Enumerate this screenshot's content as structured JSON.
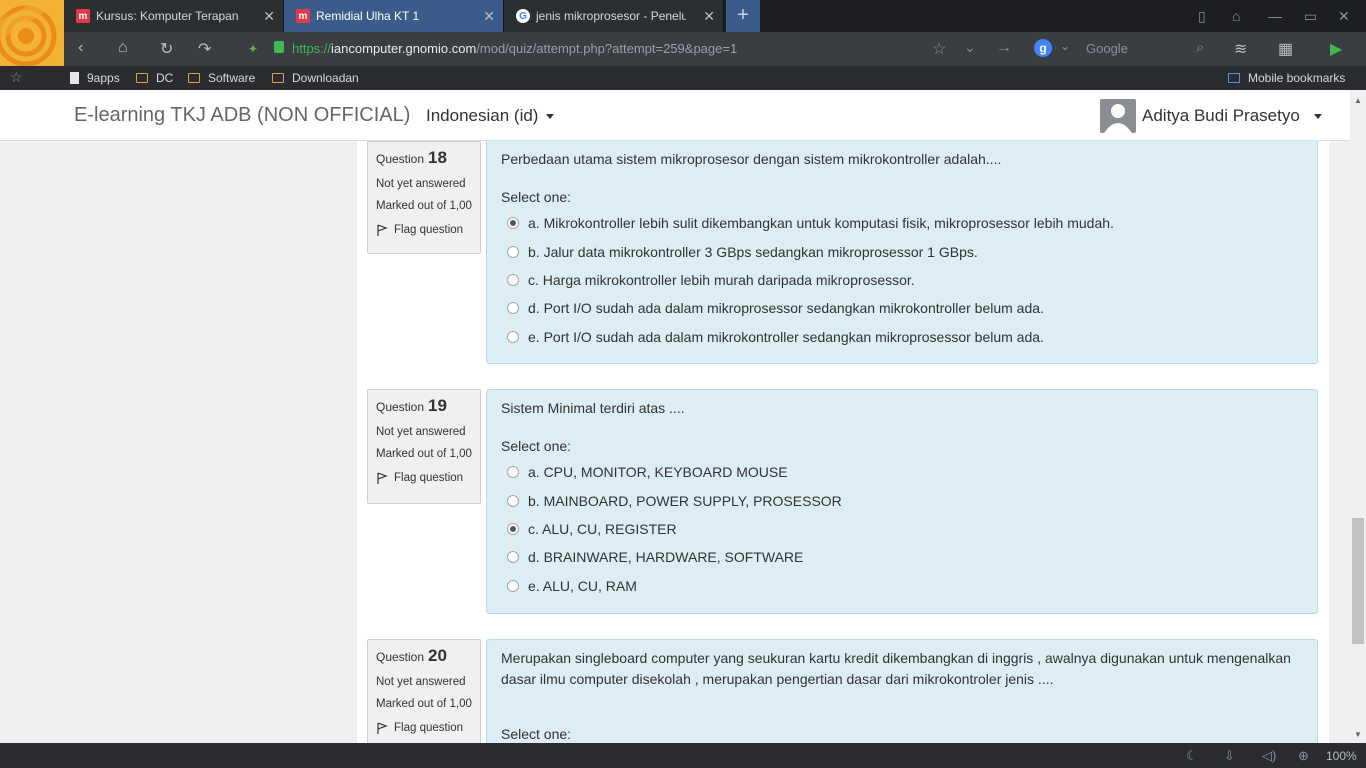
{
  "browser": {
    "tabs": [
      {
        "title": "Kursus: Komputer Terapan",
        "favicon": "moodle-icon",
        "active": false
      },
      {
        "title": "Remidial Ulha KT 1",
        "favicon": "moodle-icon",
        "active": true
      },
      {
        "title": "jenis mikroprosesor - Penelu",
        "favicon": "google-icon",
        "active": false
      }
    ],
    "url": {
      "scheme": "https://",
      "host": "iancomputer.gnomio.com",
      "path": "/mod/quiz/attempt.php?attempt=259&page=1"
    },
    "search_placeholder": "Google",
    "search_engine_icon": "g",
    "bookmarks": [
      "9apps",
      "DC",
      "Software",
      "Downloadan"
    ],
    "mobile_bookmarks": "Mobile bookmarks",
    "zoom": "100%"
  },
  "navbar": {
    "brand": "E-learning TKJ ADB (NON OFFICIAL)",
    "language": "Indonesian (id)",
    "user": "Aditya Budi Prasetyo"
  },
  "questions": [
    {
      "label": "Question",
      "number": "18",
      "state": "Not yet answered",
      "mark": "Marked out of 1,00",
      "flag": "Flag question",
      "text": "Perbedaan utama sistem mikroprosesor dengan sistem mikrokontroller adalah....",
      "prompt": "Select one:",
      "answers": [
        {
          "text": "a. Mikrokontroller lebih sulit dikembangkan untuk komputasi fisik, mikroprosessor lebih mudah.",
          "checked": true
        },
        {
          "text": "b. Jalur data mikrokontroller 3 GBps sedangkan mikroprosessor 1 GBps.",
          "checked": false
        },
        {
          "text": "c. Harga mikrokontroller lebih murah daripada mikroprosessor.",
          "checked": false
        },
        {
          "text": "d. Port I/O sudah ada dalam mikroprosessor sedangkan mikrokontroller belum ada.",
          "checked": false
        },
        {
          "text": "e. Port I/O sudah ada dalam mikrokontroller sedangkan mikroprosessor belum ada.",
          "checked": false
        }
      ]
    },
    {
      "label": "Question",
      "number": "19",
      "state": "Not yet answered",
      "mark": "Marked out of 1,00",
      "flag": "Flag question",
      "text": "Sistem Minimal terdiri atas ....",
      "prompt": "Select one:",
      "answers": [
        {
          "text": "a. CPU, MONITOR, KEYBOARD MOUSE",
          "checked": false
        },
        {
          "text": "b. MAINBOARD, POWER SUPPLY, PROSESSOR",
          "checked": false
        },
        {
          "text": "c. ALU, CU, REGISTER",
          "checked": true
        },
        {
          "text": "d. BRAINWARE, HARDWARE, SOFTWARE",
          "checked": false
        },
        {
          "text": "e. ALU, CU, RAM",
          "checked": false
        }
      ]
    },
    {
      "label": "Question",
      "number": "20",
      "state": "Not yet answered",
      "mark": "Marked out of 1,00",
      "flag": "Flag question",
      "text": "Merupakan singleboard computer yang seukuran kartu kredit dikembangkan di inggris , awalnya digunakan untuk mengenalkan dasar ilmu computer disekolah , merupakan pengertian dasar dari mikrokontroler jenis ....",
      "prompt": "Select one:"
    }
  ]
}
